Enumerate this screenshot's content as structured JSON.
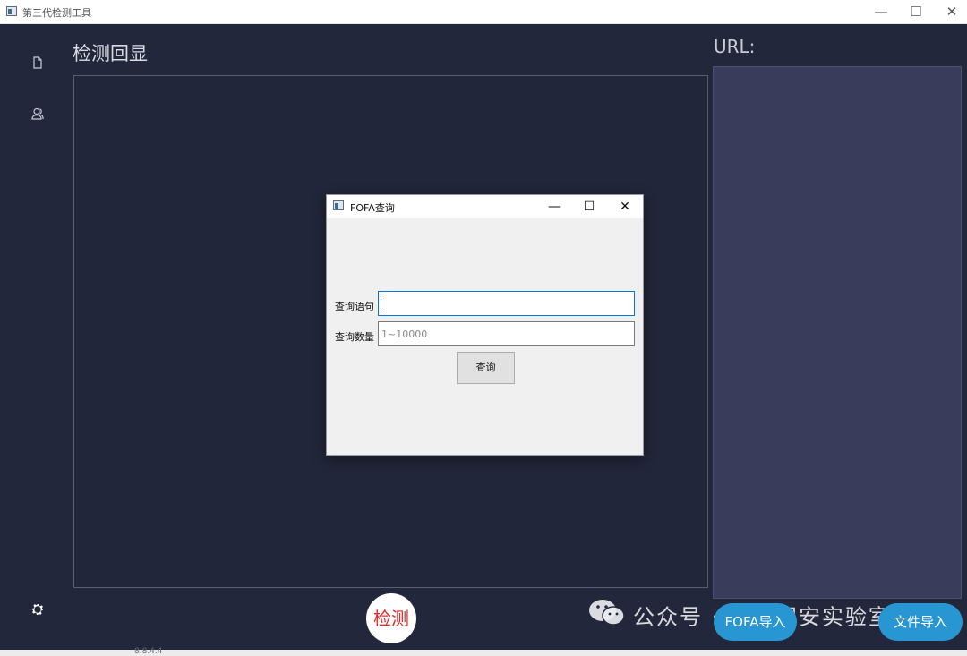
{
  "window": {
    "title": "第三代检测工具",
    "minimize": "—",
    "maximize": "☐",
    "close": "✕"
  },
  "sidebar": {
    "items": [
      {
        "icon": "file-icon"
      },
      {
        "icon": "users-icon"
      },
      {
        "icon": "gear-icon"
      }
    ]
  },
  "main": {
    "display_title": "检测回显",
    "url_label": "URL:",
    "detect_button": "检测",
    "fofa_button": "FOFA导入",
    "file_import_button": "文件导入"
  },
  "watermark": {
    "text": "公众号 · 暗影网安实验室"
  },
  "background_residue": {
    "text": "8.8.4.4"
  },
  "dialog": {
    "title": "FOFA查询",
    "minimize": "—",
    "maximize": "☐",
    "close": "✕",
    "query_label": "查询语句",
    "query_value": "",
    "count_label": "查询数量",
    "count_placeholder": "1~10000",
    "submit_button": "查询"
  },
  "colors": {
    "app_background": "#23273b",
    "url_panel": "#393c5a",
    "accent_button": "#2996d4",
    "detect_text": "#e32b2b"
  }
}
